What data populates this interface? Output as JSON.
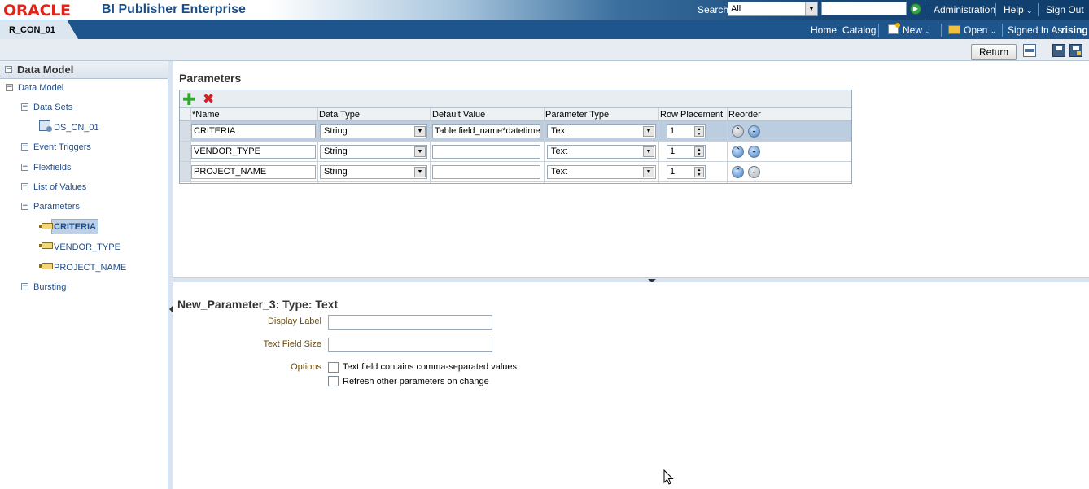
{
  "header": {
    "logo": "ORACLE",
    "product": "BI Publisher Enterprise",
    "search_label": "Search",
    "search_scope": "All",
    "search_value": "",
    "links": [
      "Administration",
      "Help",
      "Sign Out"
    ]
  },
  "navbar": {
    "doc_tab": "R_CON_01",
    "home": "Home",
    "catalog": "Catalog",
    "new": "New",
    "open": "Open",
    "signed_in_label": "Signed In As",
    "signed_in_user": "rising"
  },
  "toolbar": {
    "return_label": "Return"
  },
  "sidebar": {
    "title": "Data Model",
    "root": "Data Model",
    "items": [
      {
        "label": "Data Sets",
        "children": [
          "DS_CN_01"
        ]
      },
      {
        "label": "Event Triggers"
      },
      {
        "label": "Flexfields"
      },
      {
        "label": "List of Values"
      },
      {
        "label": "Parameters",
        "children": [
          "CRITERIA",
          "VENDOR_TYPE",
          "PROJECT_NAME"
        ]
      },
      {
        "label": "Bursting"
      }
    ],
    "selected": "CRITERIA"
  },
  "parameters": {
    "title": "Parameters",
    "columns": [
      "*Name",
      "Data Type",
      "Default Value",
      "Parameter Type",
      "Row Placement",
      "Reorder"
    ],
    "rows": [
      {
        "name": "CRITERIA",
        "data_type": "String",
        "default_value": "Table.field_name*datetime",
        "param_type": "Text",
        "row_placement": "1"
      },
      {
        "name": "VENDOR_TYPE",
        "data_type": "String",
        "default_value": "",
        "param_type": "Text",
        "row_placement": "1"
      },
      {
        "name": "PROJECT_NAME",
        "data_type": "String",
        "default_value": "",
        "param_type": "Text",
        "row_placement": "1"
      }
    ]
  },
  "detail": {
    "title": "New_Parameter_3: Type: Text",
    "display_label": "Display Label",
    "text_field_size": "Text Field Size",
    "options_label": "Options",
    "option1": "Text field contains comma-separated values",
    "option2": "Refresh other parameters on change"
  },
  "colors": {
    "header_dark": "#0f3d6b",
    "nav_bar": "#1e558c",
    "link_blue": "#1f4d8c",
    "selected_row": "#bccde0",
    "oracle_red": "#e2231a"
  }
}
